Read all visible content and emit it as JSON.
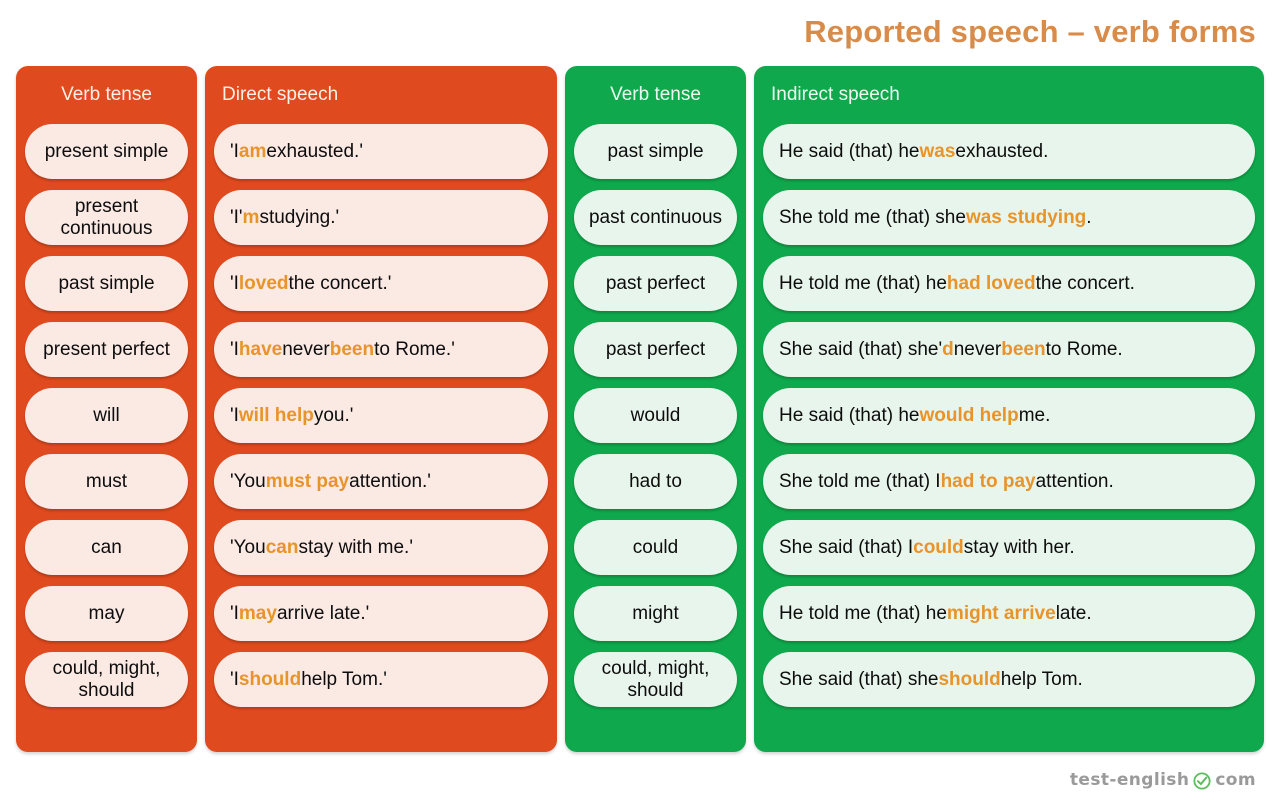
{
  "title": "Reported speech – verb forms",
  "colors": {
    "orange_panel": "#e04a1f",
    "green_panel": "#0fa84c",
    "orange_pill": "#fbe9e4",
    "green_pill": "#e8f5ec",
    "highlight": "#e8942a",
    "title": "#d98c4a",
    "logo": "#9a9a9a"
  },
  "columns": {
    "direct_tense_header": "Verb tense",
    "direct_speech_header": "Direct speech",
    "indirect_tense_header": "Verb tense",
    "indirect_speech_header": "Indirect speech"
  },
  "rows": [
    {
      "direct_tense": "present simple",
      "direct_speech": [
        {
          "t": "'I ",
          "hl": false
        },
        {
          "t": "am",
          "hl": true
        },
        {
          "t": " exhausted.'",
          "hl": false
        }
      ],
      "indirect_tense": "past simple",
      "indirect_speech": [
        {
          "t": "He said (that) he ",
          "hl": false
        },
        {
          "t": "was",
          "hl": true
        },
        {
          "t": " exhausted.",
          "hl": false
        }
      ]
    },
    {
      "direct_tense": "present continuous",
      "direct_speech": [
        {
          "t": "'I'",
          "hl": false
        },
        {
          "t": "m",
          "hl": true
        },
        {
          "t": " studying.'",
          "hl": false
        }
      ],
      "indirect_tense": "past continuous",
      "indirect_speech": [
        {
          "t": "She told me (that) she ",
          "hl": false
        },
        {
          "t": "was studying",
          "hl": true
        },
        {
          "t": ".",
          "hl": false
        }
      ]
    },
    {
      "direct_tense": "past simple",
      "direct_speech": [
        {
          "t": "'I ",
          "hl": false
        },
        {
          "t": "loved",
          "hl": true
        },
        {
          "t": " the concert.'",
          "hl": false
        }
      ],
      "indirect_tense": "past perfect",
      "indirect_speech": [
        {
          "t": "He told me (that) he ",
          "hl": false
        },
        {
          "t": "had loved",
          "hl": true
        },
        {
          "t": " the concert.",
          "hl": false
        }
      ]
    },
    {
      "direct_tense": "present perfect",
      "direct_speech": [
        {
          "t": "'I ",
          "hl": false
        },
        {
          "t": "have",
          "hl": true
        },
        {
          "t": " never ",
          "hl": false
        },
        {
          "t": "been",
          "hl": true
        },
        {
          "t": " to Rome.'",
          "hl": false
        }
      ],
      "indirect_tense": "past perfect",
      "indirect_speech": [
        {
          "t": "She said (that) she'",
          "hl": false
        },
        {
          "t": "d",
          "hl": true
        },
        {
          "t": " never ",
          "hl": false
        },
        {
          "t": "been",
          "hl": true
        },
        {
          "t": " to Rome.",
          "hl": false
        }
      ]
    },
    {
      "direct_tense": "will",
      "direct_speech": [
        {
          "t": "'I ",
          "hl": false
        },
        {
          "t": "will help",
          "hl": true
        },
        {
          "t": " you.'",
          "hl": false
        }
      ],
      "indirect_tense": "would",
      "indirect_speech": [
        {
          "t": "He said (that) he ",
          "hl": false
        },
        {
          "t": "would help",
          "hl": true
        },
        {
          "t": " me.",
          "hl": false
        }
      ]
    },
    {
      "direct_tense": "must",
      "direct_speech": [
        {
          "t": "'You ",
          "hl": false
        },
        {
          "t": "must pay",
          "hl": true
        },
        {
          "t": " attention.'",
          "hl": false
        }
      ],
      "indirect_tense": "had to",
      "indirect_speech": [
        {
          "t": "She told me (that) I ",
          "hl": false
        },
        {
          "t": "had to pay",
          "hl": true
        },
        {
          "t": " attention.",
          "hl": false
        }
      ]
    },
    {
      "direct_tense": "can",
      "direct_speech": [
        {
          "t": "'You ",
          "hl": false
        },
        {
          "t": "can",
          "hl": true
        },
        {
          "t": " stay with me.'",
          "hl": false
        }
      ],
      "indirect_tense": "could",
      "indirect_speech": [
        {
          "t": "She said (that) I ",
          "hl": false
        },
        {
          "t": "could",
          "hl": true
        },
        {
          "t": " stay with her.",
          "hl": false
        }
      ]
    },
    {
      "direct_tense": "may",
      "direct_speech": [
        {
          "t": "'I ",
          "hl": false
        },
        {
          "t": "may",
          "hl": true
        },
        {
          "t": " arrive late.'",
          "hl": false
        }
      ],
      "indirect_tense": "might",
      "indirect_speech": [
        {
          "t": "He told me (that) he ",
          "hl": false
        },
        {
          "t": "might arrive",
          "hl": true
        },
        {
          "t": " late.",
          "hl": false
        }
      ]
    },
    {
      "direct_tense": "could, might, should",
      "direct_speech": [
        {
          "t": "'I ",
          "hl": false
        },
        {
          "t": "should",
          "hl": true
        },
        {
          "t": " help Tom.'",
          "hl": false
        }
      ],
      "indirect_tense": "could, might, should",
      "indirect_speech": [
        {
          "t": "She said (that) she ",
          "hl": false
        },
        {
          "t": "should",
          "hl": true
        },
        {
          "t": " help Tom.",
          "hl": false
        }
      ]
    }
  ],
  "footer": {
    "logo_left": "test-english",
    "logo_icon": "check-circle-icon",
    "logo_right": "com"
  }
}
